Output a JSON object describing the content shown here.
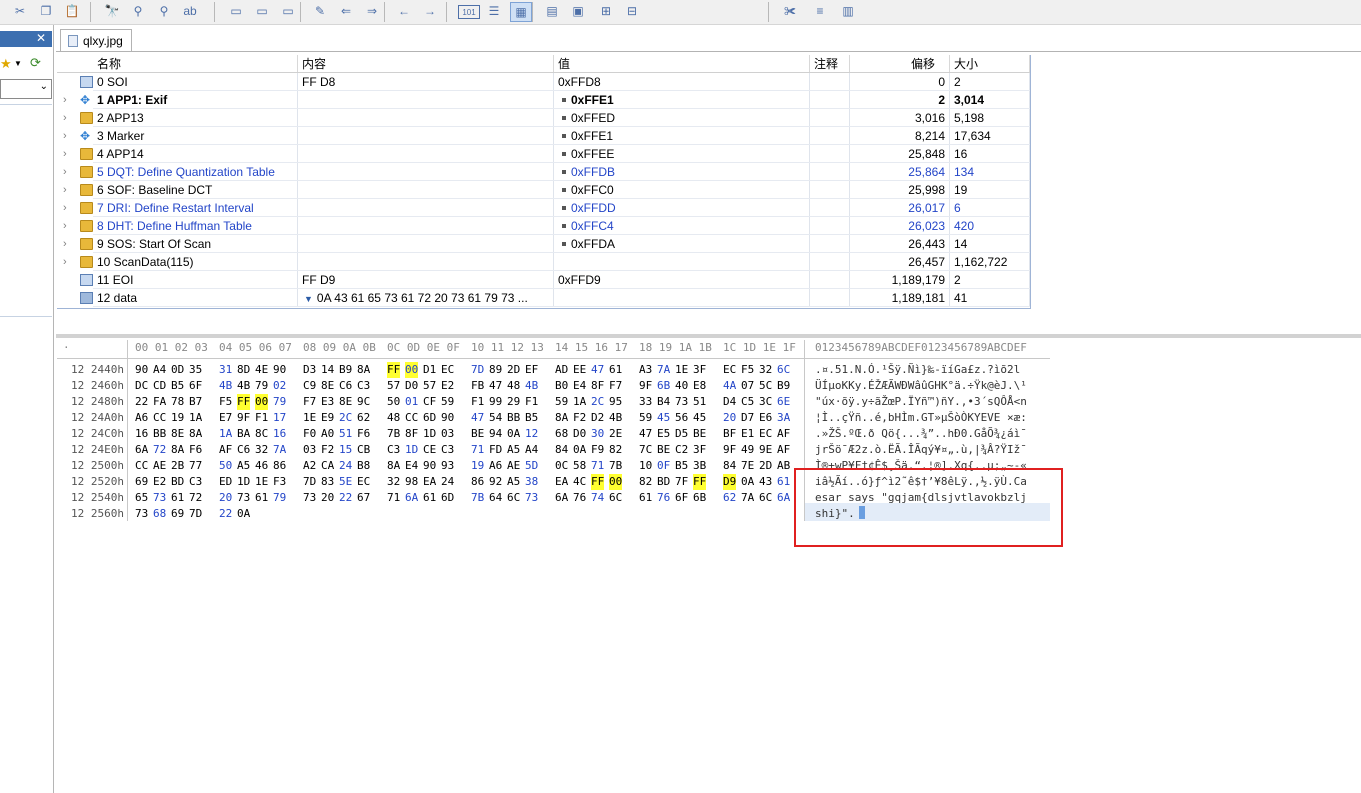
{
  "toolbar": {
    "icons": [
      "cut-icon",
      "copy-icon",
      "paste-icon",
      "find-icon",
      "find-prev-icon",
      "find-next-icon",
      "replace-icon",
      "bookmark-icon",
      "bookmark-prev-icon",
      "bookmark-next-icon",
      "edit-icon",
      "back-icon",
      "forward-icon",
      "nav-back-icon",
      "nav-forward-icon",
      "binary-view-icon",
      "list-view-icon",
      "table-view-icon",
      "template-icon",
      "export-icon",
      "expand-icon",
      "collapse-icon",
      "tools-icon",
      "layers-icon",
      "calculator-icon"
    ]
  },
  "document_tab": {
    "label": "qlxy.jpg"
  },
  "tree": {
    "headers": {
      "name": "名称",
      "content": "内容",
      "value": "值",
      "comment": "注释",
      "offset": "偏移",
      "size": "大小"
    },
    "rows": [
      {
        "name": "0 SOI",
        "content": "FF D8",
        "value": "0xFFD8",
        "offset": "0",
        "size": "2",
        "icon": "grid",
        "style": "normal",
        "expand": false,
        "bullet": false,
        "caret": false
      },
      {
        "name": "1 APP1: Exif",
        "content": "",
        "value": "0xFFE1",
        "offset": "2",
        "size": "3,014",
        "icon": "diamond",
        "style": "bold",
        "expand": true,
        "bullet": true,
        "caret": false
      },
      {
        "name": "2 APP13",
        "content": "",
        "value": "0xFFED",
        "offset": "3,016",
        "size": "5,198",
        "icon": "folder",
        "style": "normal",
        "expand": true,
        "bullet": true,
        "caret": false
      },
      {
        "name": "3 Marker",
        "content": "",
        "value": "0xFFE1",
        "offset": "8,214",
        "size": "17,634",
        "icon": "diamond",
        "style": "normal",
        "expand": true,
        "bullet": true,
        "caret": false
      },
      {
        "name": "4 APP14",
        "content": "",
        "value": "0xFFEE",
        "offset": "25,848",
        "size": "16",
        "icon": "folder",
        "style": "normal",
        "expand": true,
        "bullet": true,
        "caret": false
      },
      {
        "name": "5 DQT: Define Quantization Table",
        "content": "",
        "value": "0xFFDB",
        "offset": "25,864",
        "size": "134",
        "icon": "folder",
        "style": "blue",
        "expand": true,
        "bullet": true,
        "caret": false
      },
      {
        "name": "6 SOF: Baseline DCT",
        "content": "",
        "value": "0xFFC0",
        "offset": "25,998",
        "size": "19",
        "icon": "folder",
        "style": "normal",
        "expand": true,
        "bullet": true,
        "caret": false
      },
      {
        "name": "7 DRI: Define Restart Interval",
        "content": "",
        "value": "0xFFDD",
        "offset": "26,017",
        "size": "6",
        "icon": "folder",
        "style": "blue",
        "expand": true,
        "bullet": true,
        "caret": false
      },
      {
        "name": "8 DHT: Define Huffman Table",
        "content": "",
        "value": "0xFFC4",
        "offset": "26,023",
        "size": "420",
        "icon": "folder",
        "style": "blue",
        "expand": true,
        "bullet": true,
        "caret": false
      },
      {
        "name": "9 SOS: Start Of Scan",
        "content": "",
        "value": "0xFFDA",
        "offset": "26,443",
        "size": "14",
        "icon": "folder",
        "style": "normal",
        "expand": true,
        "bullet": true,
        "caret": false
      },
      {
        "name": "10 ScanData(115)",
        "content": "",
        "value": "",
        "offset": "26,457",
        "size": "1,162,722",
        "icon": "folder",
        "style": "normal",
        "expand": true,
        "bullet": false,
        "caret": false
      },
      {
        "name": "11 EOI",
        "content": "FF D9",
        "value": "0xFFD9",
        "offset": "1,189,179",
        "size": "2",
        "icon": "grid",
        "style": "normal",
        "expand": false,
        "bullet": false,
        "caret": false
      },
      {
        "name": "12 data",
        "content": "0A 43 61 65 73 61 72 20 73 61 79 73 ...",
        "value": "",
        "offset": "1,189,181",
        "size": "41",
        "icon": "data",
        "style": "normal",
        "expand": false,
        "bullet": false,
        "caret": true
      }
    ]
  },
  "hex": {
    "header_offset": "·",
    "header_groups": [
      "00 01 02 03",
      "04 05 06 07",
      "08 09 0A 0B",
      "0C 0D 0E 0F",
      "10 11 12 13",
      "14 15 16 17",
      "18 19 1A 1B",
      "1C 1D 1E 1F"
    ],
    "header_ascii": "0123456789ABCDEF0123456789ABCDEF",
    "rows": [
      {
        "offset": "12 2440h",
        "groups": [
          [
            "90",
            "A4",
            "0D",
            "35"
          ],
          [
            "31",
            "8D",
            "4E",
            "90"
          ],
          [
            "D3",
            "14",
            "B9",
            "8A"
          ],
          [
            "FF",
            "00",
            "D1",
            "EC"
          ],
          [
            "7D",
            "89",
            "2D",
            "EF"
          ],
          [
            "AD",
            "EE",
            "47",
            "61"
          ],
          [
            "A3",
            "7A",
            "1E",
            "3F"
          ],
          [
            "EC",
            "F5",
            "32",
            "6C"
          ]
        ],
        "ascii": ".¤.51.N.Ó.¹Šÿ.Ñì}‰-ï­íGa£z.?ìõ2l"
      },
      {
        "offset": "12 2460h",
        "groups": [
          [
            "DC",
            "CD",
            "B5",
            "6F"
          ],
          [
            "4B",
            "4B",
            "79",
            "02"
          ],
          [
            "C9",
            "8E",
            "C6",
            "C3"
          ],
          [
            "57",
            "D0",
            "57",
            "E2"
          ],
          [
            "FB",
            "47",
            "48",
            "4B"
          ],
          [
            "B0",
            "E4",
            "8F",
            "F7"
          ],
          [
            "9F",
            "6B",
            "40",
            "E8"
          ],
          [
            "4A",
            "07",
            "5C",
            "B9"
          ]
        ],
        "ascii": "ÜÍµoKKy.ÉŽÆÃWÐWâûGHK°ä.÷Ÿk@èJ.\\¹"
      },
      {
        "offset": "12 2480h",
        "groups": [
          [
            "22",
            "FA",
            "78",
            "B7"
          ],
          [
            "F5",
            "FF",
            "00",
            "79"
          ],
          [
            "F7",
            "E3",
            "8E",
            "9C"
          ],
          [
            "50",
            "01",
            "CF",
            "59"
          ],
          [
            "F1",
            "99",
            "29",
            "F1"
          ],
          [
            "59",
            "1A",
            "2C",
            "95"
          ],
          [
            "33",
            "B4",
            "73",
            "51"
          ],
          [
            "D4",
            "C5",
            "3C",
            "6E"
          ]
        ],
        "ascii": "\"úx·õÿ.y÷ãŽœP.ÏYñ™)ñY.,•3´sQÔÅ<n"
      },
      {
        "offset": "12 24A0h",
        "groups": [
          [
            "A6",
            "CC",
            "19",
            "1A"
          ],
          [
            "E7",
            "9F",
            "F1",
            "17"
          ],
          [
            "1E",
            "E9",
            "2C",
            "62"
          ],
          [
            "48",
            "CC",
            "6D",
            "90"
          ],
          [
            "47",
            "54",
            "BB",
            "B5"
          ],
          [
            "8A",
            "F2",
            "D2",
            "4B"
          ],
          [
            "59",
            "45",
            "56",
            "45"
          ],
          [
            "20",
            "D7",
            "E6",
            "3A"
          ]
        ],
        "ascii": "¦Ì..çŸñ..é,bHÌm.GT»µŠòÒKYEVE ×æ:"
      },
      {
        "offset": "12 24C0h",
        "groups": [
          [
            "16",
            "BB",
            "8E",
            "8A"
          ],
          [
            "1A",
            "BA",
            "8C",
            "16"
          ],
          [
            "F0",
            "A0",
            "51",
            "F6"
          ],
          [
            "7B",
            "8F",
            "1D",
            "03"
          ],
          [
            "BE",
            "94",
            "0A",
            "12"
          ],
          [
            "68",
            "D0",
            "30",
            "2E"
          ],
          [
            "47",
            "E5",
            "D5",
            "BE"
          ],
          [
            "BF",
            "E1",
            "EC",
            "AF"
          ]
        ],
        "ascii": ".»ŽŠ.ºŒ.ð Qö{...¾”..hÐ0.GåÕ¾¿áì¯"
      },
      {
        "offset": "12 24E0h",
        "groups": [
          [
            "6A",
            "72",
            "8A",
            "F6"
          ],
          [
            "AF",
            "C6",
            "32",
            "7A"
          ],
          [
            "03",
            "F2",
            "15",
            "CB"
          ],
          [
            "C3",
            "1D",
            "CE",
            "C3"
          ],
          [
            "71",
            "FD",
            "A5",
            "A4"
          ],
          [
            "84",
            "0A",
            "F9",
            "82"
          ],
          [
            "7C",
            "BE",
            "C2",
            "3F"
          ],
          [
            "9F",
            "49",
            "9E",
            "AF"
          ]
        ],
        "ascii": "jrŠö¯Æ2z.ò.ËÃ.ÎÃqý¥¤„.ù‚|¾Â?ŸIž¯"
      },
      {
        "offset": "12 2500h",
        "groups": [
          [
            "CC",
            "AE",
            "2B",
            "77"
          ],
          [
            "50",
            "A5",
            "46",
            "86"
          ],
          [
            "A2",
            "CA",
            "24",
            "B8"
          ],
          [
            "8A",
            "E4",
            "90",
            "93"
          ],
          [
            "19",
            "A6",
            "AE",
            "5D"
          ],
          [
            "0C",
            "58",
            "71",
            "7B"
          ],
          [
            "10",
            "0F",
            "B5",
            "3B"
          ],
          [
            "84",
            "7E",
            "2D",
            "AB"
          ]
        ],
        "ascii": "Ì®+wP¥F†¢Ê$¸Šä.“.¦®].Xq{..µ;„~-«"
      },
      {
        "offset": "12 2520h",
        "groups": [
          [
            "69",
            "E2",
            "BD",
            "C3"
          ],
          [
            "ED",
            "1D",
            "1E",
            "F3"
          ],
          [
            "7D",
            "83",
            "5E",
            "EC"
          ],
          [
            "32",
            "98",
            "EA",
            "24"
          ],
          [
            "86",
            "92",
            "A5",
            "38"
          ],
          [
            "EA",
            "4C",
            "FF",
            "00"
          ],
          [
            "82",
            "BD",
            "7F",
            "FF"
          ],
          [
            "D9",
            "0A",
            "43",
            "61"
          ]
        ],
        "ascii": "iâ½Ãí..ó}ƒ^ì2˜ê$†’¥8êLÿ.‚½.ÿÙ.Ca"
      },
      {
        "offset": "12 2540h",
        "groups": [
          [
            "65",
            "73",
            "61",
            "72"
          ],
          [
            "20",
            "73",
            "61",
            "79"
          ],
          [
            "73",
            "20",
            "22",
            "67"
          ],
          [
            "71",
            "6A",
            "61",
            "6D"
          ],
          [
            "7B",
            "64",
            "6C",
            "73"
          ],
          [
            "6A",
            "76",
            "74",
            "6C"
          ],
          [
            "61",
            "76",
            "6F",
            "6B"
          ],
          [
            "62",
            "7A",
            "6C",
            "6A"
          ]
        ],
        "ascii": "esar says \"gqjam{dlsjvtlavokbzlj"
      },
      {
        "offset": "12 2560h",
        "groups": [
          [
            "73",
            "68",
            "69",
            "7D"
          ],
          [
            "22",
            "0A"
          ]
        ],
        "ascii": "shi}\"."
      }
    ]
  }
}
